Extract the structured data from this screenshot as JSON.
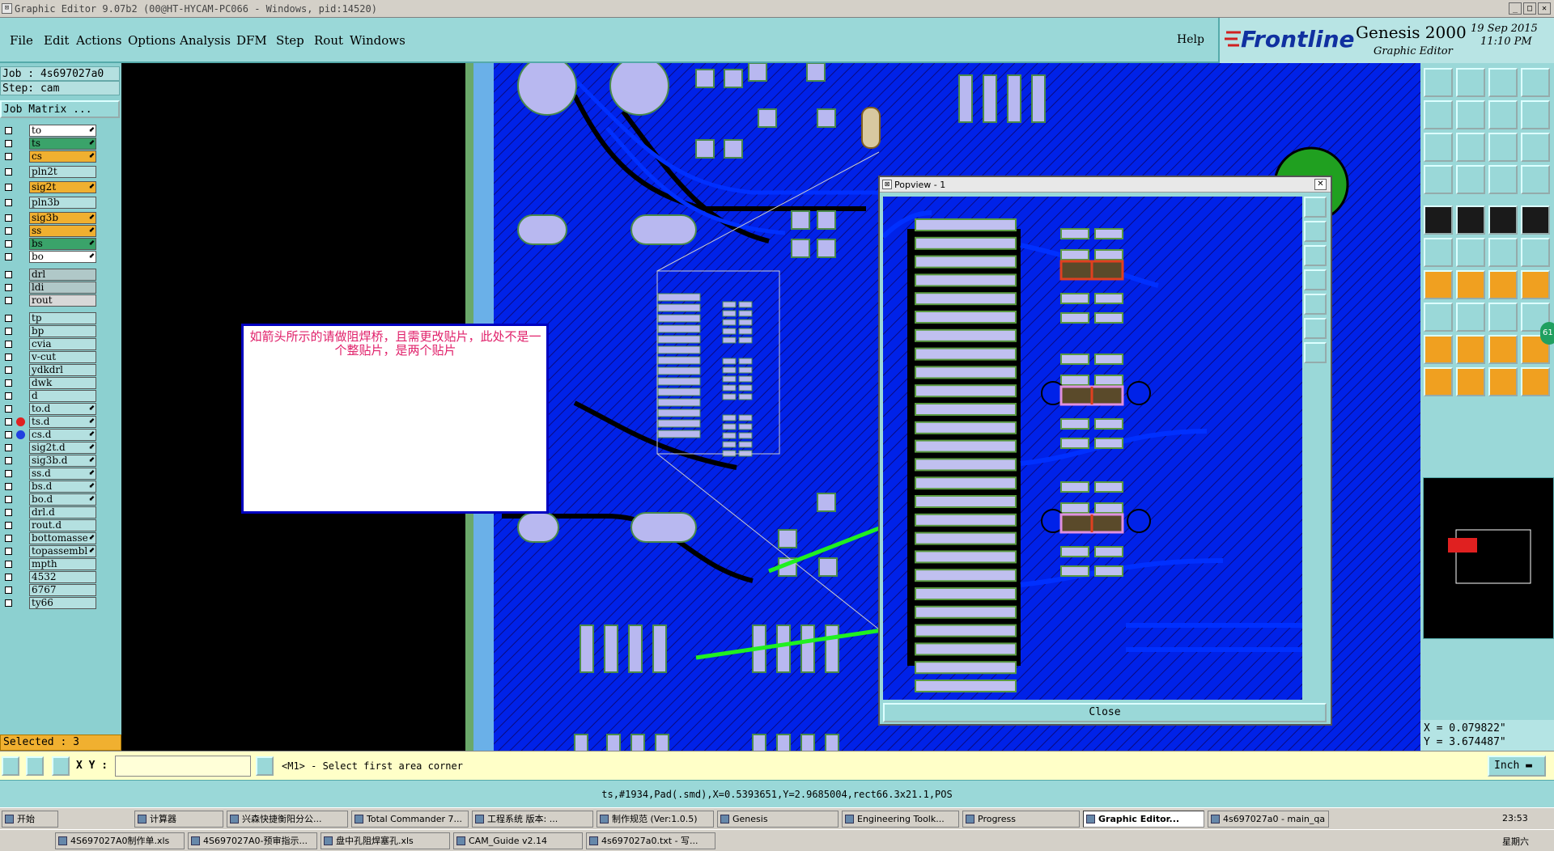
{
  "window": {
    "title": "Graphic Editor 9.07b2 (00@HT-HYCAM-PC066 - Windows, pid:14520)"
  },
  "menu": [
    "File",
    "Edit",
    "Actions",
    "Options",
    "Analysis",
    "DFM",
    "Step",
    "Rout",
    "Windows"
  ],
  "help_label": "Help",
  "brand": {
    "logo": "Frontline",
    "product": "Genesis 2000",
    "subtitle": "Graphic Editor",
    "date": "19 Sep 2015",
    "time": "11:10 PM"
  },
  "job": {
    "job_label": "Job : 4s697027a0",
    "step_label": "Step: cam",
    "matrix_label": "Job Matrix ..."
  },
  "layers": [
    {
      "name": "to",
      "color": "#ffffff",
      "arrow": "⬋"
    },
    {
      "name": "ts",
      "color": "#3aa36a",
      "arrow": "⬋"
    },
    {
      "name": "cs",
      "color": "#f0b030",
      "arrow": "⬋"
    },
    {
      "name": "pln2t",
      "color": "#b4e0e0",
      "arrow": ""
    },
    {
      "name": "sig2t",
      "color": "#f0b030",
      "arrow": "⬋"
    },
    {
      "name": "pln3b",
      "color": "#b4e0e0",
      "arrow": ""
    },
    {
      "name": "sig3b",
      "color": "#f0b030",
      "arrow": "⬋"
    },
    {
      "name": "ss",
      "color": "#f0b030",
      "arrow": "⬋"
    },
    {
      "name": "bs",
      "color": "#3aa36a",
      "arrow": "⬋"
    },
    {
      "name": "bo",
      "color": "#ffffff",
      "arrow": "⬋"
    },
    {
      "name": "drl",
      "color": "#b0c8c8",
      "arrow": ""
    },
    {
      "name": "ldi",
      "color": "#b0c8c8",
      "arrow": ""
    },
    {
      "name": "rout",
      "color": "#d8d8d8",
      "arrow": ""
    },
    {
      "name": "tp",
      "color": "#b4e0e0",
      "arrow": ""
    },
    {
      "name": "bp",
      "color": "#b4e0e0",
      "arrow": ""
    },
    {
      "name": "cvia",
      "color": "#b4e0e0",
      "arrow": ""
    },
    {
      "name": "v-cut",
      "color": "#b4e0e0",
      "arrow": ""
    },
    {
      "name": "ydkdrl",
      "color": "#b4e0e0",
      "arrow": ""
    },
    {
      "name": "dwk",
      "color": "#b4e0e0",
      "arrow": ""
    },
    {
      "name": "d",
      "color": "#b4e0e0",
      "arrow": ""
    },
    {
      "name": "to.d",
      "color": "#b4e0e0",
      "arrow": "⬋"
    },
    {
      "name": "ts.d",
      "color": "#b4e0e0",
      "arrow": "⬋"
    },
    {
      "name": "cs.d",
      "color": "#b4e0e0",
      "arrow": "⬋"
    },
    {
      "name": "sig2t.d",
      "color": "#b4e0e0",
      "arrow": "⬋"
    },
    {
      "name": "sig3b.d",
      "color": "#b4e0e0",
      "arrow": "⬋"
    },
    {
      "name": "ss.d",
      "color": "#b4e0e0",
      "arrow": "⬋"
    },
    {
      "name": "bs.d",
      "color": "#b4e0e0",
      "arrow": "⬋"
    },
    {
      "name": "bo.d",
      "color": "#b4e0e0",
      "arrow": "⬋"
    },
    {
      "name": "drl.d",
      "color": "#b4e0e0",
      "arrow": ""
    },
    {
      "name": "rout.d",
      "color": "#b4e0e0",
      "arrow": ""
    },
    {
      "name": "bottomasse",
      "color": "#b4e0e0",
      "arrow": "⬋"
    },
    {
      "name": "topassembl",
      "color": "#b4e0e0",
      "arrow": "⬋"
    },
    {
      "name": "mpth",
      "color": "#b4e0e0",
      "arrow": ""
    },
    {
      "name": "4532",
      "color": "#b4e0e0",
      "arrow": ""
    },
    {
      "name": "6767",
      "color": "#b4e0e0",
      "arrow": ""
    },
    {
      "name": "ty66",
      "color": "#b4e0e0",
      "arrow": ""
    }
  ],
  "selected_label": "Selected : 3",
  "cmd": {
    "xy_label": "X Y :",
    "input_value": "",
    "message": "<M1> - Select first area corner",
    "units": "Inch"
  },
  "status_text": "ts,#1934,Pad(.smd),X=0.5393651,Y=2.9685004,rect66.3x21.1,POS",
  "coords": {
    "x": "X = 0.079822\"",
    "y": "Y = 3.674487\""
  },
  "popview": {
    "title": "Popview - 1",
    "close_label": "Close"
  },
  "annotation": "如箭头所示的请做阻焊桥，且需更改贴片，此处不是一个整贴片，是两个贴片",
  "taskbar_row1": [
    "开始",
    "计算器",
    "兴森快捷衡阳分公...",
    "Total Commander 7...",
    "工程系统   版本: ...",
    "制作规范 (Ver:1.0.5)",
    "Genesis",
    "Engineering Toolk...",
    "Progress",
    "Graphic Editor...",
    "4s697027a0 - main_qa"
  ],
  "taskbar_row2": [
    "4S697027A0制作单.xls",
    "4S697027A0-预审指示...",
    "盘中孔阻焊塞孔.xls",
    "CAM_Guide v2.14",
    "4s697027a0.txt - 写..."
  ],
  "clock": {
    "time": "23:53",
    "day": "星期六"
  },
  "badge": "61"
}
